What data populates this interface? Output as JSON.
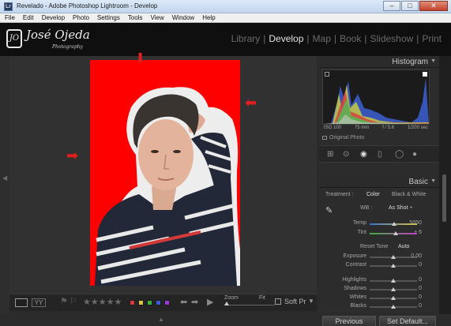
{
  "window": {
    "icon_text": "Lr",
    "title": "Revelado - Adobe Photoshop Lightroom - Develop",
    "minimize": "–",
    "maximize": "□",
    "close": "✕"
  },
  "menu": [
    "File",
    "Edit",
    "Develop",
    "Photo",
    "Settings",
    "Tools",
    "View",
    "Window",
    "Help"
  ],
  "identity": {
    "mark": "JO",
    "name": "José  Ojeda",
    "sub": "Photography"
  },
  "modules": [
    {
      "label": "Library",
      "active": false
    },
    {
      "label": "Develop",
      "active": true
    },
    {
      "label": "Map",
      "active": false
    },
    {
      "label": "Book",
      "active": false
    },
    {
      "label": "Slideshow",
      "active": false
    },
    {
      "label": "Print",
      "active": false
    }
  ],
  "colors": {
    "photo_background": "#ff0000",
    "annotation_arrow": "#e21f1f"
  },
  "histogram": {
    "title": "Histogram",
    "iso": "ISO 100",
    "focal": "75 mm",
    "aperture": "f / 5.6",
    "shutter": "1/200 sec",
    "original_photo": "Original Photo"
  },
  "basic": {
    "title": "Basic",
    "treatment_label": "Treatment :",
    "color": "Color",
    "bw": "Black & White",
    "wb_label": "WB :",
    "wb_value": "As Shot ÷",
    "temp_label": "Temp",
    "temp_value": "5050",
    "tint_label": "Tint",
    "tint_value": "+ 6",
    "tone_label": "Reset Tone",
    "auto": "Auto",
    "exposure_label": "Exposure",
    "exposure_value": "0.00",
    "contrast_label": "Contrast",
    "contrast_value": "0",
    "highlights_label": "Highlights",
    "highlights_value": "0",
    "shadows_label": "Shadows",
    "shadows_value": "0",
    "whites_label": "Whites",
    "whites_value": "0",
    "blacks_label": "Blacks",
    "blacks_value": "0"
  },
  "toolbar": {
    "view_yy": "YY",
    "stars": "★★★★★",
    "zoom_label": "Zoom",
    "zoom_fit": "Fit",
    "soft_proof": "Soft Pr"
  },
  "buttons": {
    "previous": "Previous",
    "set_default": "Set Default..."
  }
}
